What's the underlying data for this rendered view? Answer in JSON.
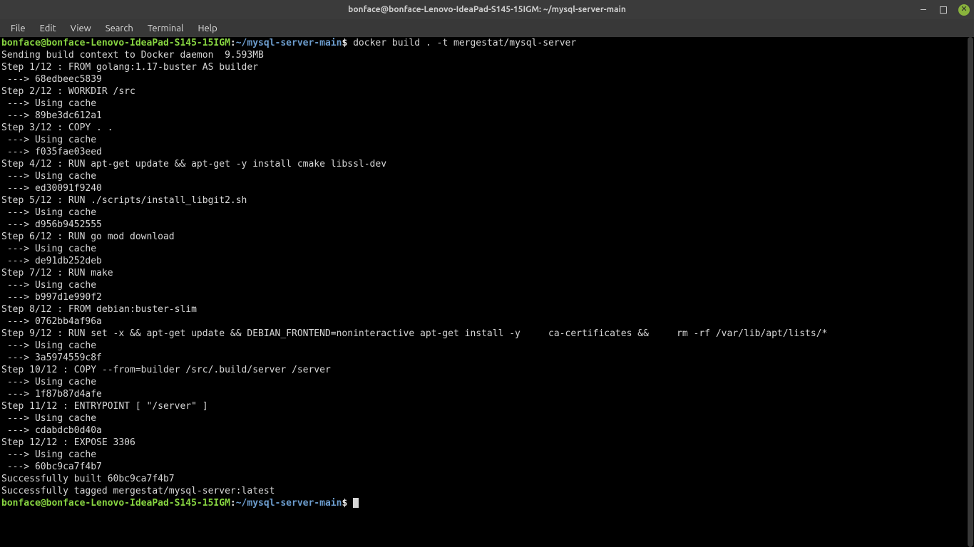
{
  "titlebar": {
    "title": "bonface@bonface-Lenovo-IdeaPad-S145-15IGM: ~/mysql-server-main"
  },
  "menubar": {
    "items": [
      "File",
      "Edit",
      "View",
      "Search",
      "Terminal",
      "Help"
    ]
  },
  "prompt": {
    "user_host": "bonface@bonface-Lenovo-IdeaPad-S145-15IGM",
    "sep": ":",
    "path": "~/mysql-server-main",
    "dollar": "$"
  },
  "command": " docker build . -t mergestat/mysql-server",
  "output_lines": [
    "Sending build context to Docker daemon  9.593MB",
    "Step 1/12 : FROM golang:1.17-buster AS builder",
    " ---> 68edbeec5839",
    "Step 2/12 : WORKDIR /src",
    " ---> Using cache",
    " ---> 89be3dc612a1",
    "Step 3/12 : COPY . .",
    " ---> Using cache",
    " ---> f035fae03eed",
    "Step 4/12 : RUN apt-get update && apt-get -y install cmake libssl-dev",
    " ---> Using cache",
    " ---> ed30091f9240",
    "Step 5/12 : RUN ./scripts/install_libgit2.sh",
    " ---> Using cache",
    " ---> d956b9452555",
    "Step 6/12 : RUN go mod download",
    " ---> Using cache",
    " ---> de91db252deb",
    "Step 7/12 : RUN make",
    " ---> Using cache",
    " ---> b997d1e990f2",
    "Step 8/12 : FROM debian:buster-slim",
    " ---> 0762bb4af96a",
    "Step 9/12 : RUN set -x && apt-get update && DEBIAN_FRONTEND=noninteractive apt-get install -y     ca-certificates &&     rm -rf /var/lib/apt/lists/*",
    " ---> Using cache",
    " ---> 3a5974559c8f",
    "Step 10/12 : COPY --from=builder /src/.build/server /server",
    " ---> Using cache",
    " ---> 1f87b87d4afe",
    "Step 11/12 : ENTRYPOINT [ \"/server\" ]",
    " ---> Using cache",
    " ---> cdabdcb0d40a",
    "Step 12/12 : EXPOSE 3306",
    " ---> Using cache",
    " ---> 60bc9ca7f4b7",
    "Successfully built 60bc9ca7f4b7",
    "Successfully tagged mergestat/mysql-server:latest"
  ]
}
